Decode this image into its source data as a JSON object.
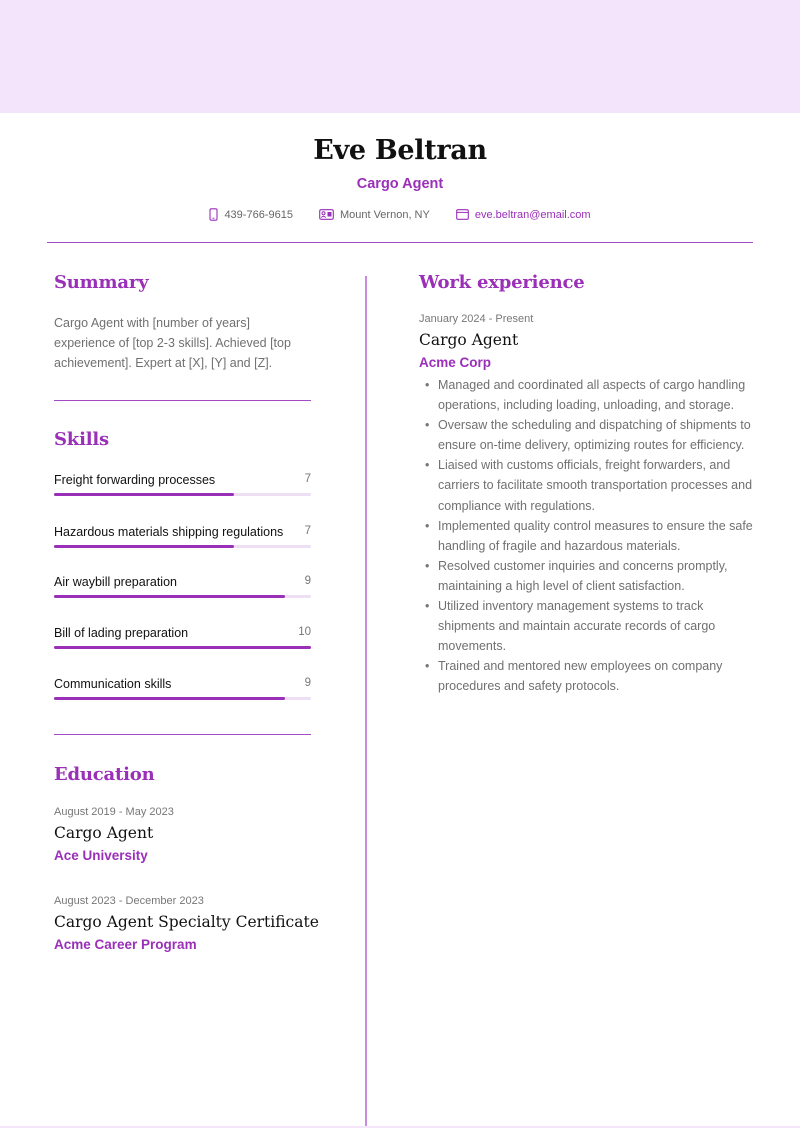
{
  "colors": {
    "accent": "#9a2fb8",
    "band": "#f3e4fb",
    "divider": "#a24bc2",
    "muted_text": "#707070"
  },
  "header": {
    "name": "Eve Beltran",
    "title": "Cargo Agent",
    "contacts": [
      {
        "icon": "phone-icon",
        "text": "439-766-9615"
      },
      {
        "icon": "id-card-icon",
        "text": "Mount Vernon, NY"
      },
      {
        "icon": "envelope-icon",
        "text": "eve.beltran@email.com"
      }
    ]
  },
  "summary": {
    "heading": "Summary",
    "text": "Cargo Agent with [number of years] experience of [top 2-3 skills]. Achieved [top achievement]. Expert at [X], [Y] and [Z]."
  },
  "skills": {
    "heading": "Skills",
    "max_level": 10,
    "items": [
      {
        "name": "Freight forwarding processes",
        "level": 7
      },
      {
        "name": "Hazardous materials shipping regulations",
        "level": 7
      },
      {
        "name": "Air waybill preparation",
        "level": 9
      },
      {
        "name": "Bill of lading preparation",
        "level": 10
      },
      {
        "name": "Communication skills",
        "level": 9
      }
    ]
  },
  "education": {
    "heading": "Education",
    "items": [
      {
        "dates": "August 2019 - May 2023",
        "degree": "Cargo Agent",
        "school": "Ace University"
      },
      {
        "dates": "August 2023 - December 2023",
        "degree": "Cargo Agent Specialty Certificate",
        "school": "Acme Career Program"
      }
    ]
  },
  "work": {
    "heading": "Work experience",
    "items": [
      {
        "dates": "January 2024 - Present",
        "role": "Cargo Agent",
        "company": "Acme Corp",
        "bullets": [
          "Managed and coordinated all aspects of cargo handling operations, including loading, unloading, and storage.",
          "Oversaw the scheduling and dispatching of shipments to ensure on-time delivery, optimizing routes for efficiency.",
          "Liaised with customs officials, freight forwarders, and carriers to facilitate smooth transportation processes and compliance with regulations.",
          "Implemented quality control measures to ensure the safe handling of fragile and hazardous materials.",
          "Resolved customer inquiries and concerns promptly, maintaining a high level of client satisfaction.",
          "Utilized inventory management systems to track shipments and maintain accurate records of cargo movements.",
          "Trained and mentored new employees on company procedures and safety protocols."
        ]
      }
    ]
  }
}
